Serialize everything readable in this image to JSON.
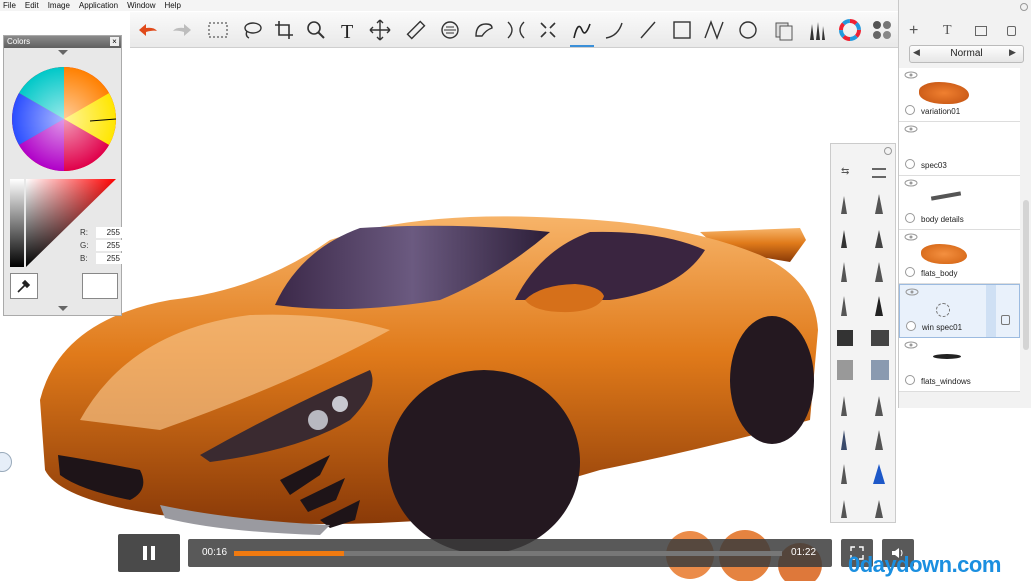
{
  "menu": [
    "File",
    "Edit",
    "Image",
    "Application",
    "Window",
    "Help"
  ],
  "toolbar": {
    "tools": [
      "undo-icon",
      "redo-icon",
      "rect-select-icon",
      "lasso-icon",
      "crop-icon",
      "zoom-icon",
      "text-icon",
      "move-icon",
      "ruler-icon",
      "ellipse-guide-icon",
      "french-curve-icon",
      "symmetry-icon",
      "distort-icon",
      "freehand-stroke-icon",
      "curve-icon",
      "line-icon",
      "rectangle-icon",
      "polyline-icon",
      "ellipse-icon",
      "copic-icon",
      "brush-library-icon",
      "color-wheel-icon",
      "swatches-icon"
    ],
    "active_tool": "freehand-stroke-icon"
  },
  "colors_panel": {
    "title": "Colors",
    "r_label": "R:",
    "g_label": "G:",
    "b_label": "B:",
    "r": "255",
    "g": "255",
    "b": "255"
  },
  "layers_panel": {
    "blend_mode": "Normal",
    "layers": [
      {
        "name": "variation01"
      },
      {
        "name": "spec03"
      },
      {
        "name": "body details"
      },
      {
        "name": "flats_body"
      },
      {
        "name": "win spec01"
      },
      {
        "name": "flats_windows"
      }
    ],
    "selected_layer": "win spec01"
  },
  "video": {
    "current_time": "00:16",
    "total_time": "01:22",
    "progress": 0.2
  },
  "watermark": "0daydown.com",
  "colors": {
    "accent": "#3a8fd8",
    "car_orange": "#e07a1a",
    "progress_orange": "#f07a10"
  }
}
